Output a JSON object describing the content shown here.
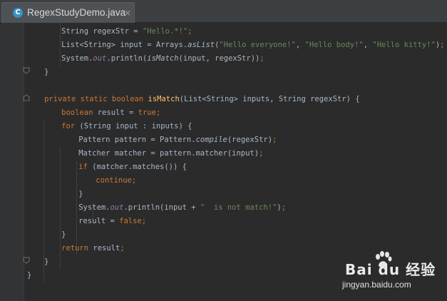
{
  "editor": {
    "tab": {
      "title": "RegexStudyDemo.java",
      "file_icon": "class-icon",
      "file_icon_letter": "C",
      "close_glyph": "×"
    }
  },
  "code_lines": [
    "        String regexStr = \"Hello.*!\";",
    "        List<String> input = Arrays.asList(\"Hello everyone!\", \"Hello body!\", \"Hello kitty!\");",
    "        System.out.println(isMatch(input, regexStr));",
    "    }",
    "",
    "    private static boolean isMatch(List<String> inputs, String regexStr) {",
    "        boolean result = true;",
    "        for (String input : inputs) {",
    "            Pattern pattern = Pattern.compile(regexStr);",
    "            Matcher matcher = pattern.matcher(input);",
    "            if (matcher.matches()) {",
    "                continue;",
    "            }",
    "            System.out.println(input + \"  is not match!\");",
    "            result = false;",
    "        }",
    "        return result;",
    "    }",
    "}"
  ],
  "watermark": {
    "logo": "Bai du 经验",
    "url": "jingyan.baidu.com"
  },
  "colors": {
    "background": "#2b2b2b",
    "keyword": "#cc7832",
    "string": "#6a8759",
    "static_field": "#9876aa",
    "method_decl": "#ffc66d",
    "default_text": "#a9b7c6"
  }
}
